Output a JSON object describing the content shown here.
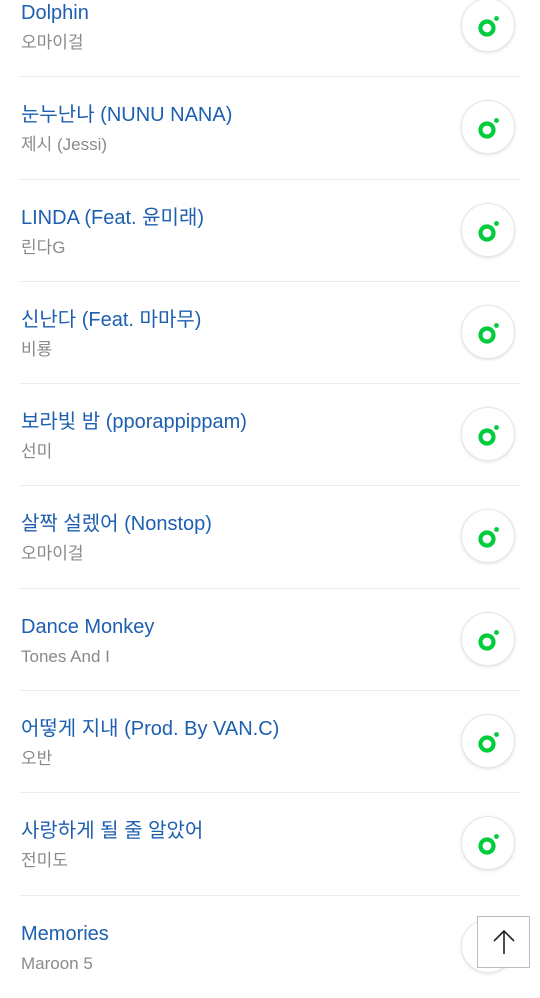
{
  "songs": [
    {
      "title": "Dolphin",
      "artist": "오마이걸"
    },
    {
      "title": "눈누난나 (NUNU NANA)",
      "artist": "제시 (Jessi)"
    },
    {
      "title": "LINDA (Feat. 윤미래)",
      "artist": "린다G"
    },
    {
      "title": "신난다 (Feat. 마마무)",
      "artist": "비룡"
    },
    {
      "title": "보라빛 밤 (pporappippam)",
      "artist": "선미"
    },
    {
      "title": "살짝 설렜어 (Nonstop)",
      "artist": "오마이걸"
    },
    {
      "title": "Dance Monkey",
      "artist": "Tones And I"
    },
    {
      "title": "어떻게 지내 (Prod. By VAN.C)",
      "artist": "오반"
    },
    {
      "title": "사랑하게 될 줄 알았어",
      "artist": "전미도"
    },
    {
      "title": "Memories",
      "artist": "Maroon 5"
    }
  ],
  "icons": {
    "play": "melon-play-icon",
    "scroll_top": "arrow-up-icon"
  },
  "colors": {
    "title": "#1d5fb0",
    "artist": "#8a8a8a",
    "accent": "#00cd3c"
  }
}
